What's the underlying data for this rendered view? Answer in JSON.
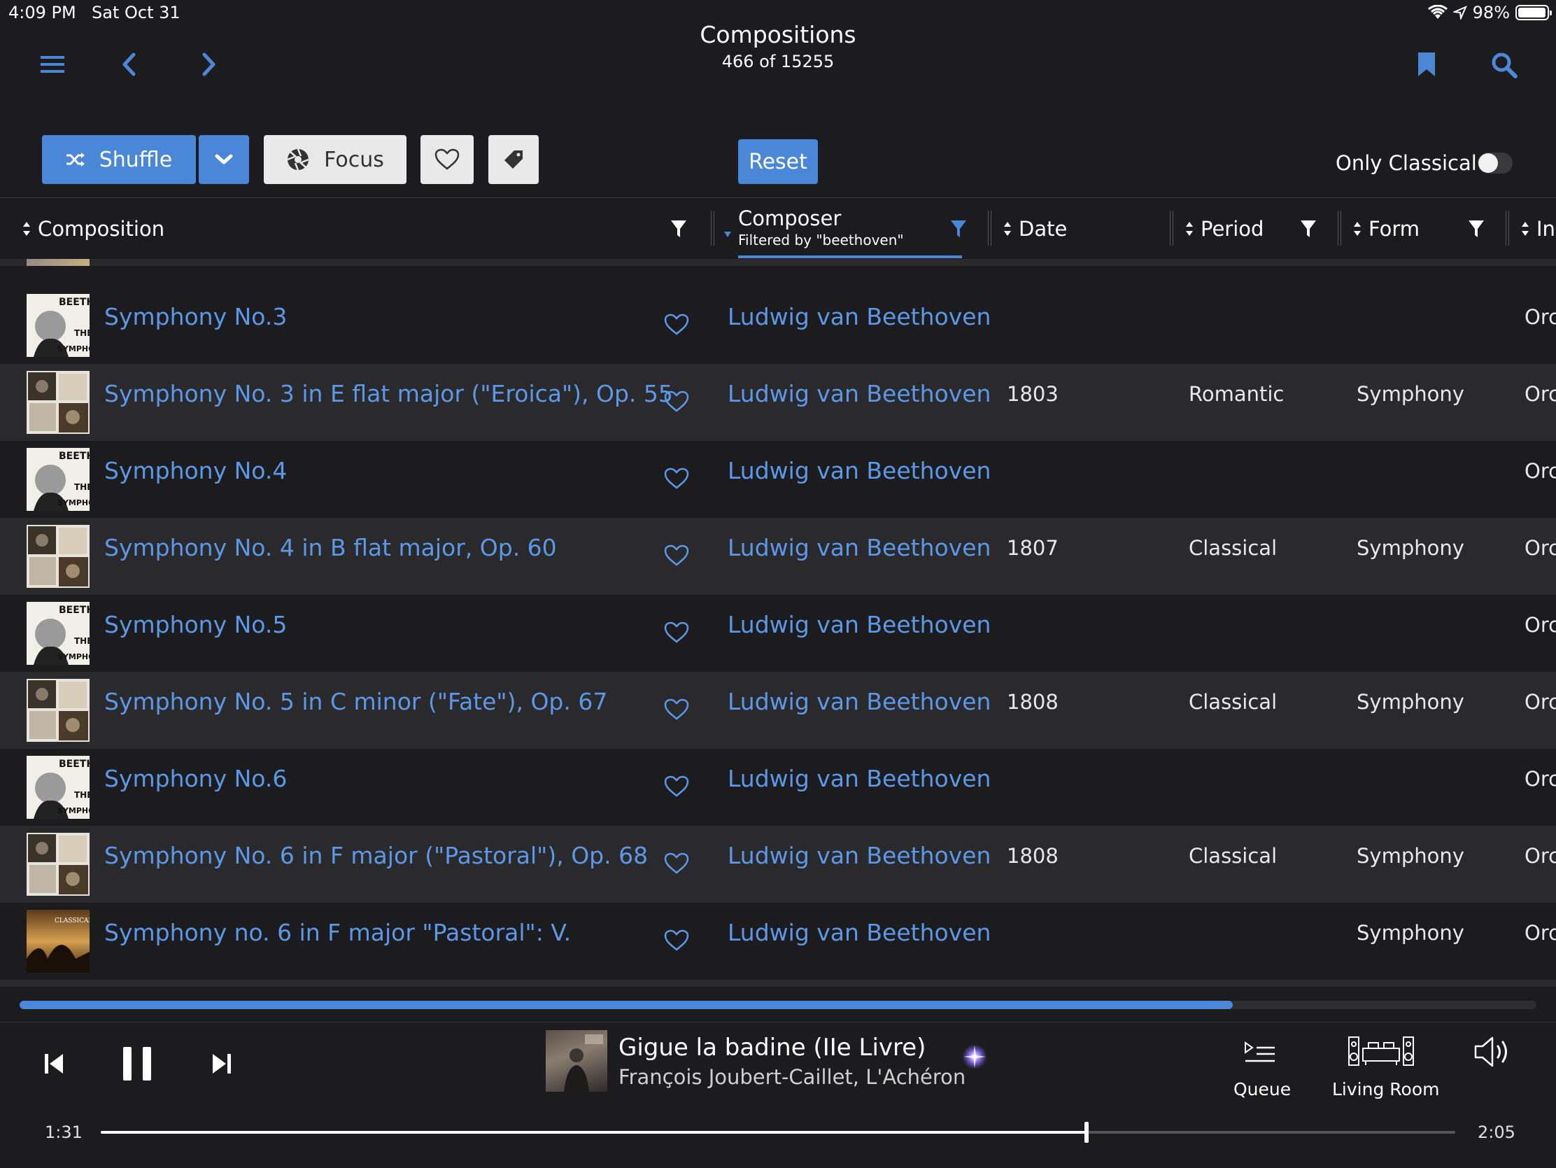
{
  "status_bar": {
    "time": "4:09 PM",
    "date": "Sat Oct 31",
    "battery": "98%",
    "battery_level": 0.98
  },
  "nav": {
    "title": "Compositions",
    "subtitle": "466 of 15255"
  },
  "toolbar": {
    "shuffle_label": "Shuffle",
    "focus_label": "Focus",
    "reset_label": "Reset",
    "only_classical_label": "Only Classical",
    "only_classical_on": false
  },
  "columns": {
    "composition": "Composition",
    "composer": "Composer",
    "composer_filter": "Filtered by \"beethoven\"",
    "date": "Date",
    "period": "Period",
    "form": "Form",
    "instrumentation": "Ins"
  },
  "rows": [
    {
      "title": "Symphony No.3",
      "composer": "Ludwig van Beethoven",
      "date": "",
      "period": "",
      "form": "",
      "instr": "Orc",
      "art": "beethoven-symphonies"
    },
    {
      "title": "Symphony No. 3 in E flat major (\"Eroica\"), Op. 55",
      "composer": "Ludwig van Beethoven",
      "date": "1803",
      "period": "Romantic",
      "form": "Symphony",
      "instr": "Orc",
      "art": "collage"
    },
    {
      "title": "Symphony No.4",
      "composer": "Ludwig van Beethoven",
      "date": "",
      "period": "",
      "form": "",
      "instr": "Orc",
      "art": "beethoven-symphonies"
    },
    {
      "title": "Symphony No. 4 in B flat major, Op. 60",
      "composer": "Ludwig van Beethoven",
      "date": "1807",
      "period": "Classical",
      "form": "Symphony",
      "instr": "Orc",
      "art": "collage"
    },
    {
      "title": "Symphony No.5",
      "composer": "Ludwig van Beethoven",
      "date": "",
      "period": "",
      "form": "",
      "instr": "Orc",
      "art": "beethoven-symphonies"
    },
    {
      "title": "Symphony No. 5 in C minor (\"Fate\"), Op. 67",
      "composer": "Ludwig van Beethoven",
      "date": "1808",
      "period": "Classical",
      "form": "Symphony",
      "instr": "Orc",
      "art": "collage"
    },
    {
      "title": "Symphony No.6",
      "composer": "Ludwig van Beethoven",
      "date": "",
      "period": "",
      "form": "",
      "instr": "Orc",
      "art": "beethoven-symphonies"
    },
    {
      "title": "Symphony No. 6 in F major (\"Pastoral\"), Op. 68",
      "composer": "Ludwig van Beethoven",
      "date": "1808",
      "period": "Classical",
      "form": "Symphony",
      "instr": "Orc",
      "art": "collage"
    },
    {
      "title": "Symphony no. 6 in F major \"Pastoral\": V.",
      "composer": "Ludwig van Beethoven",
      "date": "",
      "period": "",
      "form": "Symphony",
      "instr": "Orc",
      "art": "sunset"
    }
  ],
  "scroll": {
    "visible_fraction": 0.8
  },
  "player": {
    "track_title": "Gigue la badine (IIe Livre)",
    "track_artist": "François Joubert-Caillet, L'Achéron",
    "queue_label": "Queue",
    "zone_label": "Living Room",
    "elapsed": "1:31",
    "duration": "2:05",
    "progress": 0.728
  },
  "colors": {
    "accent": "#4a87d9",
    "link": "#5b98e8",
    "background": "#1c1c1e",
    "row_alt": "#2a2a2c"
  }
}
